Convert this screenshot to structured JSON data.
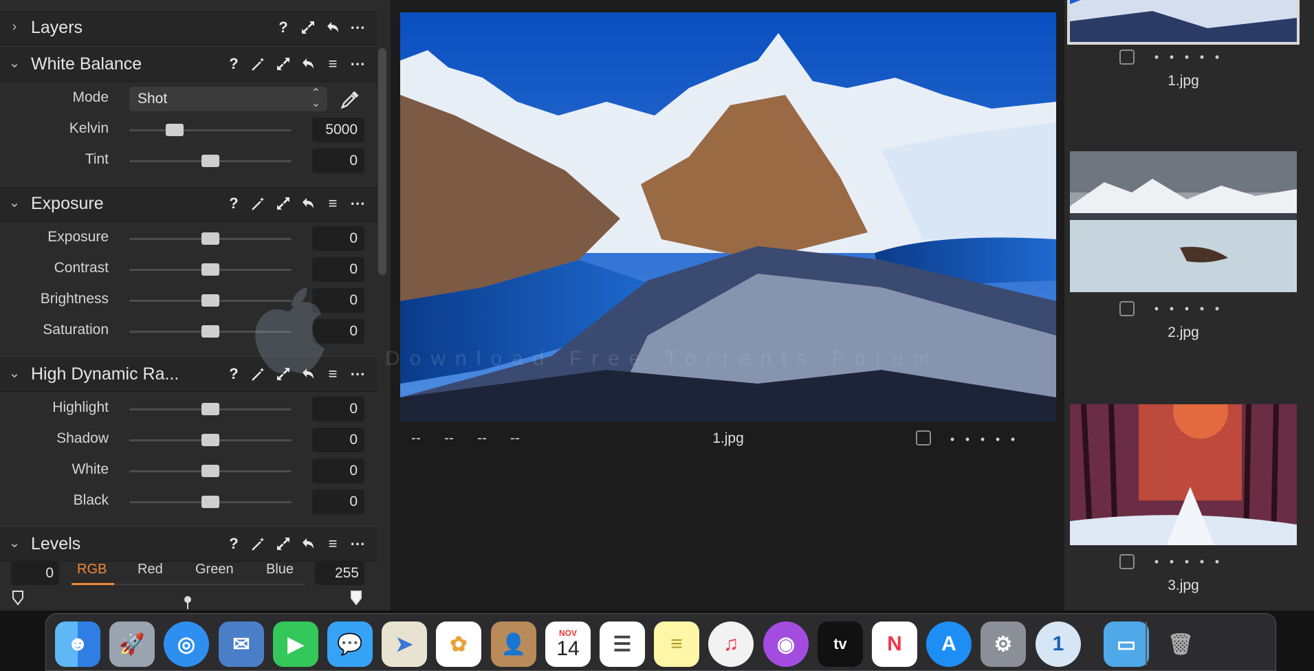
{
  "tools": {
    "layers": {
      "title": "Layers",
      "icons": [
        "help-icon",
        "expand-icon",
        "reset-icon",
        "more-icon"
      ]
    },
    "white_balance": {
      "title": "White Balance",
      "mode_label": "Mode",
      "mode_value": "Shot",
      "sliders": [
        {
          "label": "Kelvin",
          "value": "5000",
          "level": 0.28
        },
        {
          "label": "Tint",
          "value": "0",
          "level": 0.5
        }
      ]
    },
    "exposure": {
      "title": "Exposure",
      "sliders": [
        {
          "label": "Exposure",
          "value": "0",
          "level": 0.5
        },
        {
          "label": "Contrast",
          "value": "0",
          "level": 0.5
        },
        {
          "label": "Brightness",
          "value": "0",
          "level": 0.5
        },
        {
          "label": "Saturation",
          "value": "0",
          "level": 0.5
        }
      ]
    },
    "hdr": {
      "title": "High Dynamic Ra...",
      "sliders": [
        {
          "label": "Highlight",
          "value": "0",
          "level": 0.5
        },
        {
          "label": "Shadow",
          "value": "0",
          "level": 0.5
        },
        {
          "label": "White",
          "value": "0",
          "level": 0.5
        },
        {
          "label": "Black",
          "value": "0",
          "level": 0.5
        }
      ]
    },
    "levels": {
      "title": "Levels",
      "low": "0",
      "high": "255",
      "tabs": [
        "RGB",
        "Red",
        "Green",
        "Blue"
      ],
      "active_tab": "RGB"
    }
  },
  "viewer": {
    "filename": "1.jpg",
    "meta": [
      "--",
      "--",
      "--",
      "--"
    ],
    "rating": 0,
    "rating_max": 5
  },
  "browser": {
    "items": [
      {
        "name": "1.jpg",
        "selected": true
      },
      {
        "name": "2.jpg",
        "selected": false
      },
      {
        "name": "3.jpg",
        "selected": false
      }
    ]
  },
  "dock": {
    "apps": [
      "finder-icon",
      "launchpad-icon",
      "safari-icon",
      "mail-icon",
      "facetime-icon",
      "messages-icon",
      "maps-icon",
      "photos-icon",
      "contacts-icon",
      "calendar-icon",
      "reminders-icon",
      "notes-icon",
      "music-icon",
      "podcasts-icon",
      "tv-icon",
      "news-icon",
      "app-store-icon",
      "system-preferences-icon",
      "1password-icon",
      "downloads-folder-icon",
      "trash-icon"
    ],
    "calendar_month": "NOV",
    "calendar_day": "14",
    "tv_label": "tv"
  },
  "watermark": "Download Free Torrents Forum",
  "colors": {
    "accent": "#f08a3a",
    "panel": "#2b2b2b",
    "background": "#1c1c1c"
  }
}
